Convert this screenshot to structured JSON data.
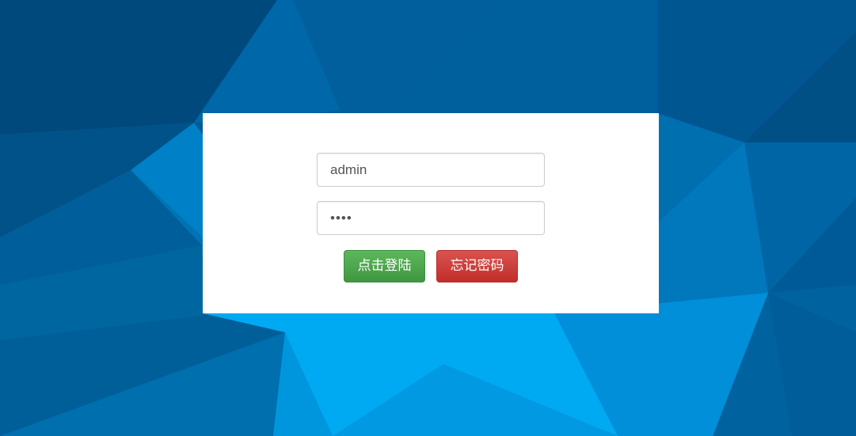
{
  "login": {
    "username_value": "admin",
    "password_value": "••••",
    "login_button_label": "点击登陆",
    "forgot_button_label": "忘记密码"
  },
  "colors": {
    "success": "#5cb85c",
    "danger": "#d9534f",
    "background": "#0077b5"
  }
}
